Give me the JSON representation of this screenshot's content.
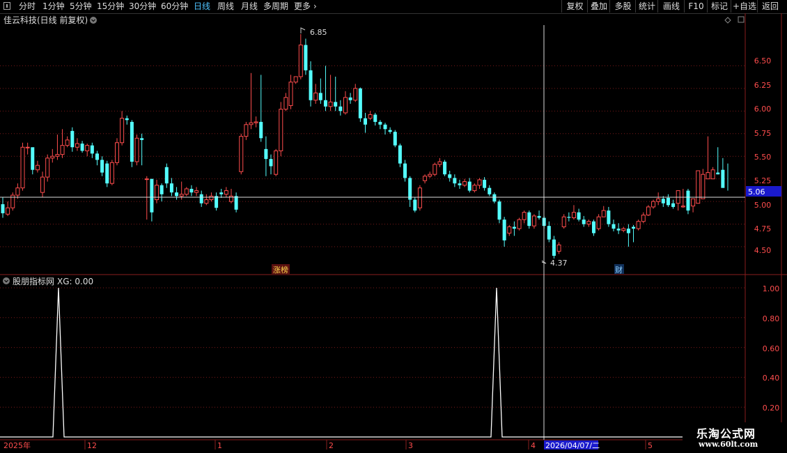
{
  "toolbar": {
    "periods": [
      "分时",
      "1分钟",
      "5分钟",
      "15分钟",
      "30分钟",
      "60分钟",
      "日线",
      "周线",
      "月线",
      "多周期",
      "更多"
    ],
    "selected": "日线",
    "more_arrow": "›",
    "right_buttons": [
      "复权",
      "叠加",
      "多股",
      "统计",
      "画线",
      "F10",
      "标记",
      "+自选",
      "返回"
    ]
  },
  "main": {
    "title": "佳云科技(日线 前复权)",
    "price_labels": [
      "6.50",
      "6.25",
      "6.00",
      "5.75",
      "5.50",
      "5.25",
      "5.00",
      "4.75",
      "4.50"
    ],
    "current_price": "5.06",
    "high_label": "6.85",
    "low_label": "4.37",
    "tags": [
      "涨榜",
      "财"
    ]
  },
  "indicator": {
    "title": "股朋指标网",
    "value_label": "XG: 0.00",
    "scale_labels": [
      "1.00",
      "0.80",
      "0.60",
      "0.40",
      "0.20"
    ],
    "signal_values": [
      1,
      1
    ]
  },
  "date_axis": {
    "labels": [
      "2025年",
      "12",
      "1",
      "2",
      "3",
      "4",
      "5"
    ],
    "cursor_date": "2026/04/07/二"
  },
  "watermark": {
    "title": "乐淘公式网",
    "url": "www.60lt.com"
  },
  "colors": {
    "up": "#ff4d4d",
    "down": "#54ffff",
    "grid": "#7a1a1a",
    "axis": "#8a1e1e",
    "accent": "#4fc3ff"
  },
  "chart_data": {
    "type": "candlestick",
    "ylim": [
      4.3,
      6.95
    ],
    "open": [
      4.97,
      4.86,
      4.93,
      5.07,
      5.15,
      5.6,
      5.6,
      5.35,
      5.1,
      5.27,
      5.48,
      5.5,
      5.52,
      5.62,
      5.78,
      5.6,
      5.64,
      5.56,
      5.62,
      5.53,
      5.46,
      5.42,
      5.2,
      5.43,
      5.65,
      5.92,
      5.88,
      5.44,
      5.7,
      5.25,
      5.25,
      5.02,
      5.18,
      5.38,
      5.2,
      5.1,
      5.06,
      5.08,
      5.14,
      5.1,
      5.08,
      4.98,
      5.02,
      5.06,
      5.1,
      5.08,
      5.0,
      5.06,
      5.33,
      5.72,
      5.85,
      5.87,
      5.88,
      5.58,
      5.47,
      5.3,
      5.56,
      6.02,
      6.06,
      6.32,
      6.38,
      6.73,
      6.45,
      6.12,
      6.2,
      6.12,
      6.05,
      6.1,
      6.05,
      5.98,
      6.15,
      6.12,
      6.25,
      5.92,
      5.92,
      5.96,
      5.88,
      5.85,
      5.79,
      5.77,
      5.62,
      5.42,
      5.26,
      5.02,
      4.93,
      5.23,
      5.28,
      5.3,
      5.41,
      5.44,
      5.3,
      5.26,
      5.2,
      5.18,
      5.22,
      5.12,
      5.18,
      5.24,
      5.15,
      5.08,
      5.0,
      4.8,
      4.65,
      4.72,
      4.7,
      4.8,
      4.88,
      4.73,
      4.84,
      4.82,
      4.73,
      4.58,
      4.45,
      4.72,
      4.83,
      4.82,
      4.88,
      4.8,
      4.75,
      4.78,
      4.7,
      4.83,
      4.9,
      4.75,
      4.7,
      4.68,
      4.7,
      4.72,
      4.7,
      4.78,
      4.85,
      4.94,
      5.0,
      5.03,
      5.04,
      4.98,
      4.98,
      4.94,
      5.12,
      4.95,
      4.98,
      5.03,
      5.25,
      5.25,
      5.32,
      5.35,
      5.3
    ],
    "close": [
      4.87,
      4.93,
      5.07,
      5.15,
      5.6,
      5.6,
      5.35,
      5.4,
      5.27,
      5.48,
      5.5,
      5.52,
      5.62,
      5.68,
      5.6,
      5.64,
      5.56,
      5.62,
      5.53,
      5.46,
      5.32,
      5.2,
      5.43,
      5.65,
      5.92,
      5.9,
      5.44,
      5.7,
      5.68,
      5.25,
      4.88,
      5.18,
      5.08,
      5.2,
      5.1,
      5.06,
      5.08,
      5.14,
      5.1,
      5.12,
      4.98,
      5.02,
      5.06,
      4.93,
      5.08,
      5.12,
      5.06,
      4.91,
      5.72,
      5.85,
      5.87,
      5.88,
      5.7,
      5.47,
      5.39,
      5.56,
      6.02,
      6.15,
      6.32,
      6.38,
      6.73,
      6.45,
      6.12,
      6.2,
      6.12,
      6.05,
      6.1,
      6.05,
      6.0,
      6.15,
      6.12,
      6.25,
      5.92,
      5.85,
      5.96,
      5.88,
      5.85,
      5.8,
      5.77,
      5.62,
      5.42,
      5.26,
      5.02,
      4.9,
      5.15,
      5.28,
      5.3,
      5.41,
      5.44,
      5.3,
      5.26,
      5.2,
      5.18,
      5.22,
      5.12,
      5.18,
      5.24,
      5.15,
      5.08,
      5.0,
      4.8,
      4.57,
      4.72,
      4.7,
      4.8,
      4.88,
      4.73,
      4.84,
      4.82,
      4.73,
      4.58,
      4.4,
      4.52,
      4.83,
      4.82,
      4.88,
      4.8,
      4.75,
      4.78,
      4.65,
      4.83,
      4.9,
      4.75,
      4.7,
      4.68,
      4.7,
      4.65,
      4.7,
      4.78,
      4.85,
      4.94,
      5.0,
      5.03,
      4.98,
      4.96,
      4.94,
      5.12,
      4.95,
      4.9,
      5.03,
      5.34,
      5.3,
      5.32,
      5.35,
      5.3,
      5.15
    ],
    "high": [
      5.05,
      5.0,
      5.1,
      5.2,
      5.65,
      5.65,
      5.45,
      5.45,
      5.33,
      5.52,
      5.58,
      5.74,
      5.8,
      5.72,
      5.82,
      5.7,
      5.67,
      5.64,
      5.65,
      5.56,
      5.5,
      5.45,
      5.46,
      5.7,
      6.0,
      5.95,
      5.9,
      5.74,
      5.75,
      5.28,
      5.25,
      5.24,
      5.2,
      5.42,
      5.26,
      5.16,
      5.22,
      5.16,
      5.18,
      5.16,
      5.12,
      5.08,
      5.1,
      5.1,
      5.14,
      5.16,
      5.14,
      5.1,
      5.75,
      5.88,
      6.42,
      5.94,
      6.4,
      5.72,
      5.52,
      5.58,
      6.1,
      6.2,
      6.4,
      6.38,
      6.85,
      6.8,
      6.55,
      6.3,
      6.36,
      6.5,
      6.4,
      6.38,
      6.12,
      6.22,
      6.2,
      6.3,
      6.26,
      5.98,
      6.0,
      5.98,
      5.9,
      5.87,
      5.82,
      5.79,
      5.64,
      5.46,
      5.28,
      5.05,
      5.18,
      5.3,
      5.33,
      5.43,
      5.48,
      5.46,
      5.34,
      5.3,
      5.24,
      5.25,
      5.26,
      5.2,
      5.26,
      5.27,
      5.18,
      5.1,
      5.02,
      4.83,
      4.74,
      4.78,
      4.82,
      4.9,
      4.9,
      4.86,
      4.9,
      4.84,
      4.78,
      4.62,
      4.55,
      4.86,
      4.88,
      4.96,
      4.92,
      4.84,
      4.8,
      4.8,
      4.86,
      4.95,
      4.94,
      4.8,
      4.76,
      4.72,
      4.75,
      4.74,
      4.8,
      4.88,
      4.96,
      5.02,
      5.1,
      5.06,
      5.08,
      5.02,
      5.0,
      5.14,
      5.14,
      5.0,
      5.04,
      5.36,
      5.72,
      5.38,
      5.6,
      5.48,
      5.42,
      5.38
    ],
    "low": [
      4.82,
      4.84,
      4.9,
      5.03,
      5.12,
      5.52,
      5.3,
      5.32,
      5.05,
      5.22,
      5.43,
      5.46,
      5.48,
      5.6,
      5.55,
      5.56,
      5.54,
      5.5,
      5.48,
      5.4,
      5.28,
      5.16,
      5.18,
      5.4,
      5.62,
      5.85,
      5.38,
      5.4,
      5.4,
      4.8,
      4.78,
      4.98,
      5.0,
      5.15,
      5.06,
      5.02,
      5.02,
      5.06,
      5.06,
      5.06,
      4.94,
      4.96,
      5.0,
      4.9,
      5.04,
      5.05,
      4.98,
      4.88,
      5.3,
      5.68,
      5.8,
      5.82,
      5.66,
      5.28,
      5.3,
      5.28,
      5.5,
      6.0,
      6.02,
      6.3,
      6.35,
      6.4,
      6.05,
      6.08,
      6.08,
      6.0,
      6.0,
      6.0,
      5.95,
      5.96,
      6.08,
      6.1,
      5.88,
      5.76,
      5.9,
      5.84,
      5.8,
      5.74,
      5.75,
      5.6,
      5.38,
      5.22,
      4.94,
      4.88,
      4.9,
      5.2,
      5.26,
      5.28,
      5.38,
      5.28,
      5.22,
      5.16,
      5.14,
      5.16,
      5.1,
      5.1,
      5.14,
      5.12,
      5.06,
      4.98,
      4.76,
      4.5,
      4.62,
      4.62,
      4.68,
      4.76,
      4.7,
      4.7,
      4.8,
      4.7,
      4.55,
      4.37,
      4.42,
      4.7,
      4.78,
      4.8,
      4.78,
      4.72,
      4.72,
      4.62,
      4.68,
      4.86,
      4.72,
      4.67,
      4.64,
      4.66,
      4.5,
      4.55,
      4.68,
      4.76,
      4.84,
      4.92,
      4.96,
      4.94,
      4.94,
      4.92,
      4.9,
      4.93,
      4.86,
      4.88,
      5.02,
      5.18,
      5.28,
      5.26,
      5.3,
      5.3,
      5.12
    ]
  }
}
